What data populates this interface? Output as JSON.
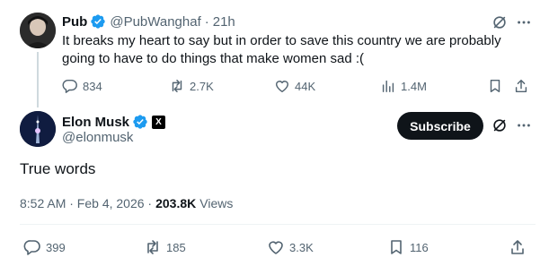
{
  "colors": {
    "verified": "#1d9bf0",
    "text": "#0f1419",
    "muted": "#536471",
    "subscribe_bg": "#0f1419"
  },
  "reply_tweet": {
    "author_name": "Pub",
    "handle": "@PubWanghaf",
    "separator": "·",
    "time": "21h",
    "text": "It breaks my heart to say but in order to save this country we are probably going to have to do things that make women sad :(",
    "stats": {
      "replies": "834",
      "reposts": "2.7K",
      "likes": "44K",
      "views": "1.4M"
    },
    "icons": [
      "grok-icon",
      "more-icon",
      "reply-icon",
      "repost-icon",
      "like-icon",
      "views-icon",
      "bookmark-icon",
      "share-icon",
      "verified-icon"
    ]
  },
  "main_tweet": {
    "author_name": "Elon Musk",
    "handle": "@elonmusk",
    "affiliate_badge": "X",
    "subscribe_label": "Subscribe",
    "text": "True words",
    "timestamp": "8:52 AM · Feb 4, 2026 ·",
    "views_count": "203.8K",
    "views_label": "Views",
    "stats": {
      "replies": "399",
      "reposts": "185",
      "likes": "3.3K",
      "bookmarks": "116"
    }
  }
}
